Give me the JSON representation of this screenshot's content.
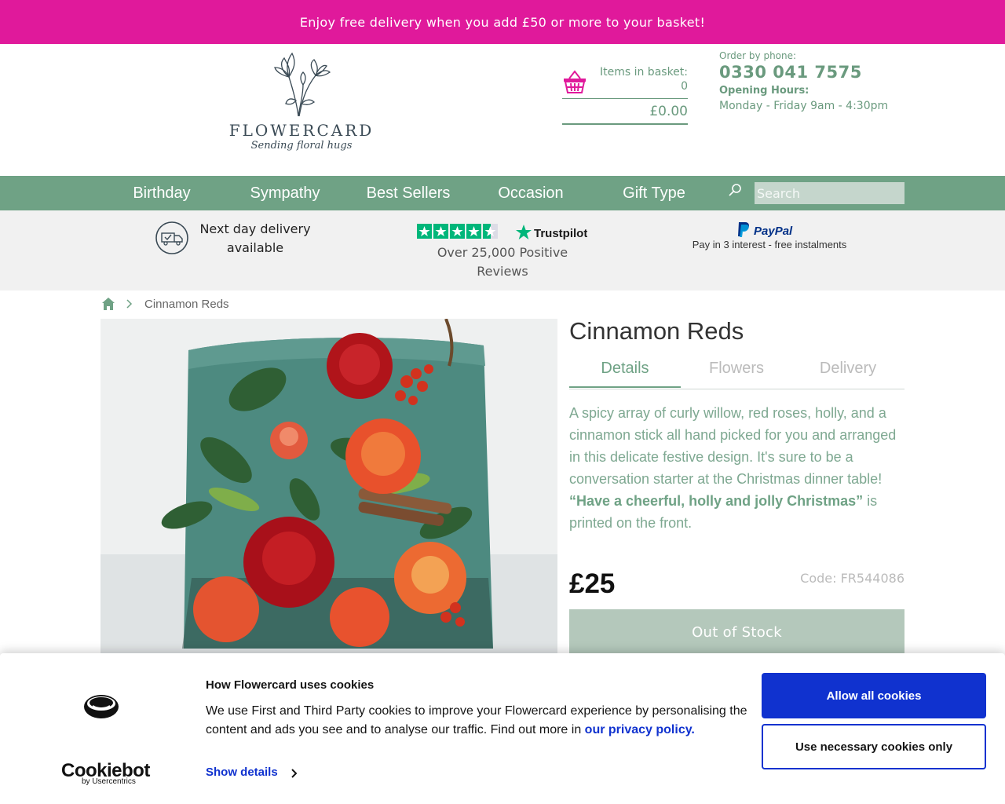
{
  "promo": {
    "text": "Enjoy free delivery when you add £50 or more to your basket!"
  },
  "brand": {
    "name": "FLOWERCARD",
    "tagline": "Sending floral hugs",
    "logo_icon": "flower-line-art"
  },
  "basket": {
    "label": "Items in basket:",
    "count": "0",
    "total": "£0.00"
  },
  "contact": {
    "order_label": "Order by phone:",
    "phone": "0330 041 7575",
    "hours_label": "Opening Hours:",
    "hours": "Monday - Friday 9am - 4:30pm"
  },
  "nav": {
    "items": [
      "Birthday",
      "Sympathy",
      "Best Sellers",
      "Occasion",
      "Gift Type"
    ],
    "search_placeholder": "Search"
  },
  "usp": {
    "delivery": "Next day delivery available",
    "trustpilot_brand": "Trustpilot",
    "trustpilot_stars": 4.5,
    "reviews": "Over 25,000 Positive Reviews",
    "paypal_brand": "PayPal",
    "paypal_text": "Pay in 3 interest - free instalments"
  },
  "breadcrumb": {
    "current": "Cinnamon Reds"
  },
  "product": {
    "title": "Cinnamon Reds",
    "tabs": [
      "Details",
      "Flowers",
      "Delivery"
    ],
    "active_tab": "Details",
    "description": "A spicy array of curly willow, red roses, holly, and a cinnamon stick all hand picked for you and arranged in this delicate festive design. It's sure to be a conversation starter at the Christmas dinner table!",
    "quote": "“Have a cheerful, holly and jolly Christmas”",
    "quote_suffix": " is printed on the front.",
    "price": "£25",
    "code": "Code: FR544086",
    "stock_button": "Out of Stock"
  },
  "cookie": {
    "title": "How Flowercard uses cookies",
    "text": "We use First and Third Party cookies to improve your Flowercard experience by personalising the content and ads you see and to analyse our traffic. Find out more in ",
    "link": "our privacy policy.",
    "show_details": "Show details",
    "brand": "Cookiebot",
    "brand_sub": "by Usercentrics",
    "allow_all": "Allow all cookies",
    "necessary_only": "Use necessary cookies only"
  },
  "colors": {
    "promo_bg": "#e0199b",
    "nav_bg": "#6fa285",
    "accent_green": "#6fa285",
    "cookie_blue": "#1032cf",
    "out_of_stock_bg": "#b4c8bb"
  }
}
